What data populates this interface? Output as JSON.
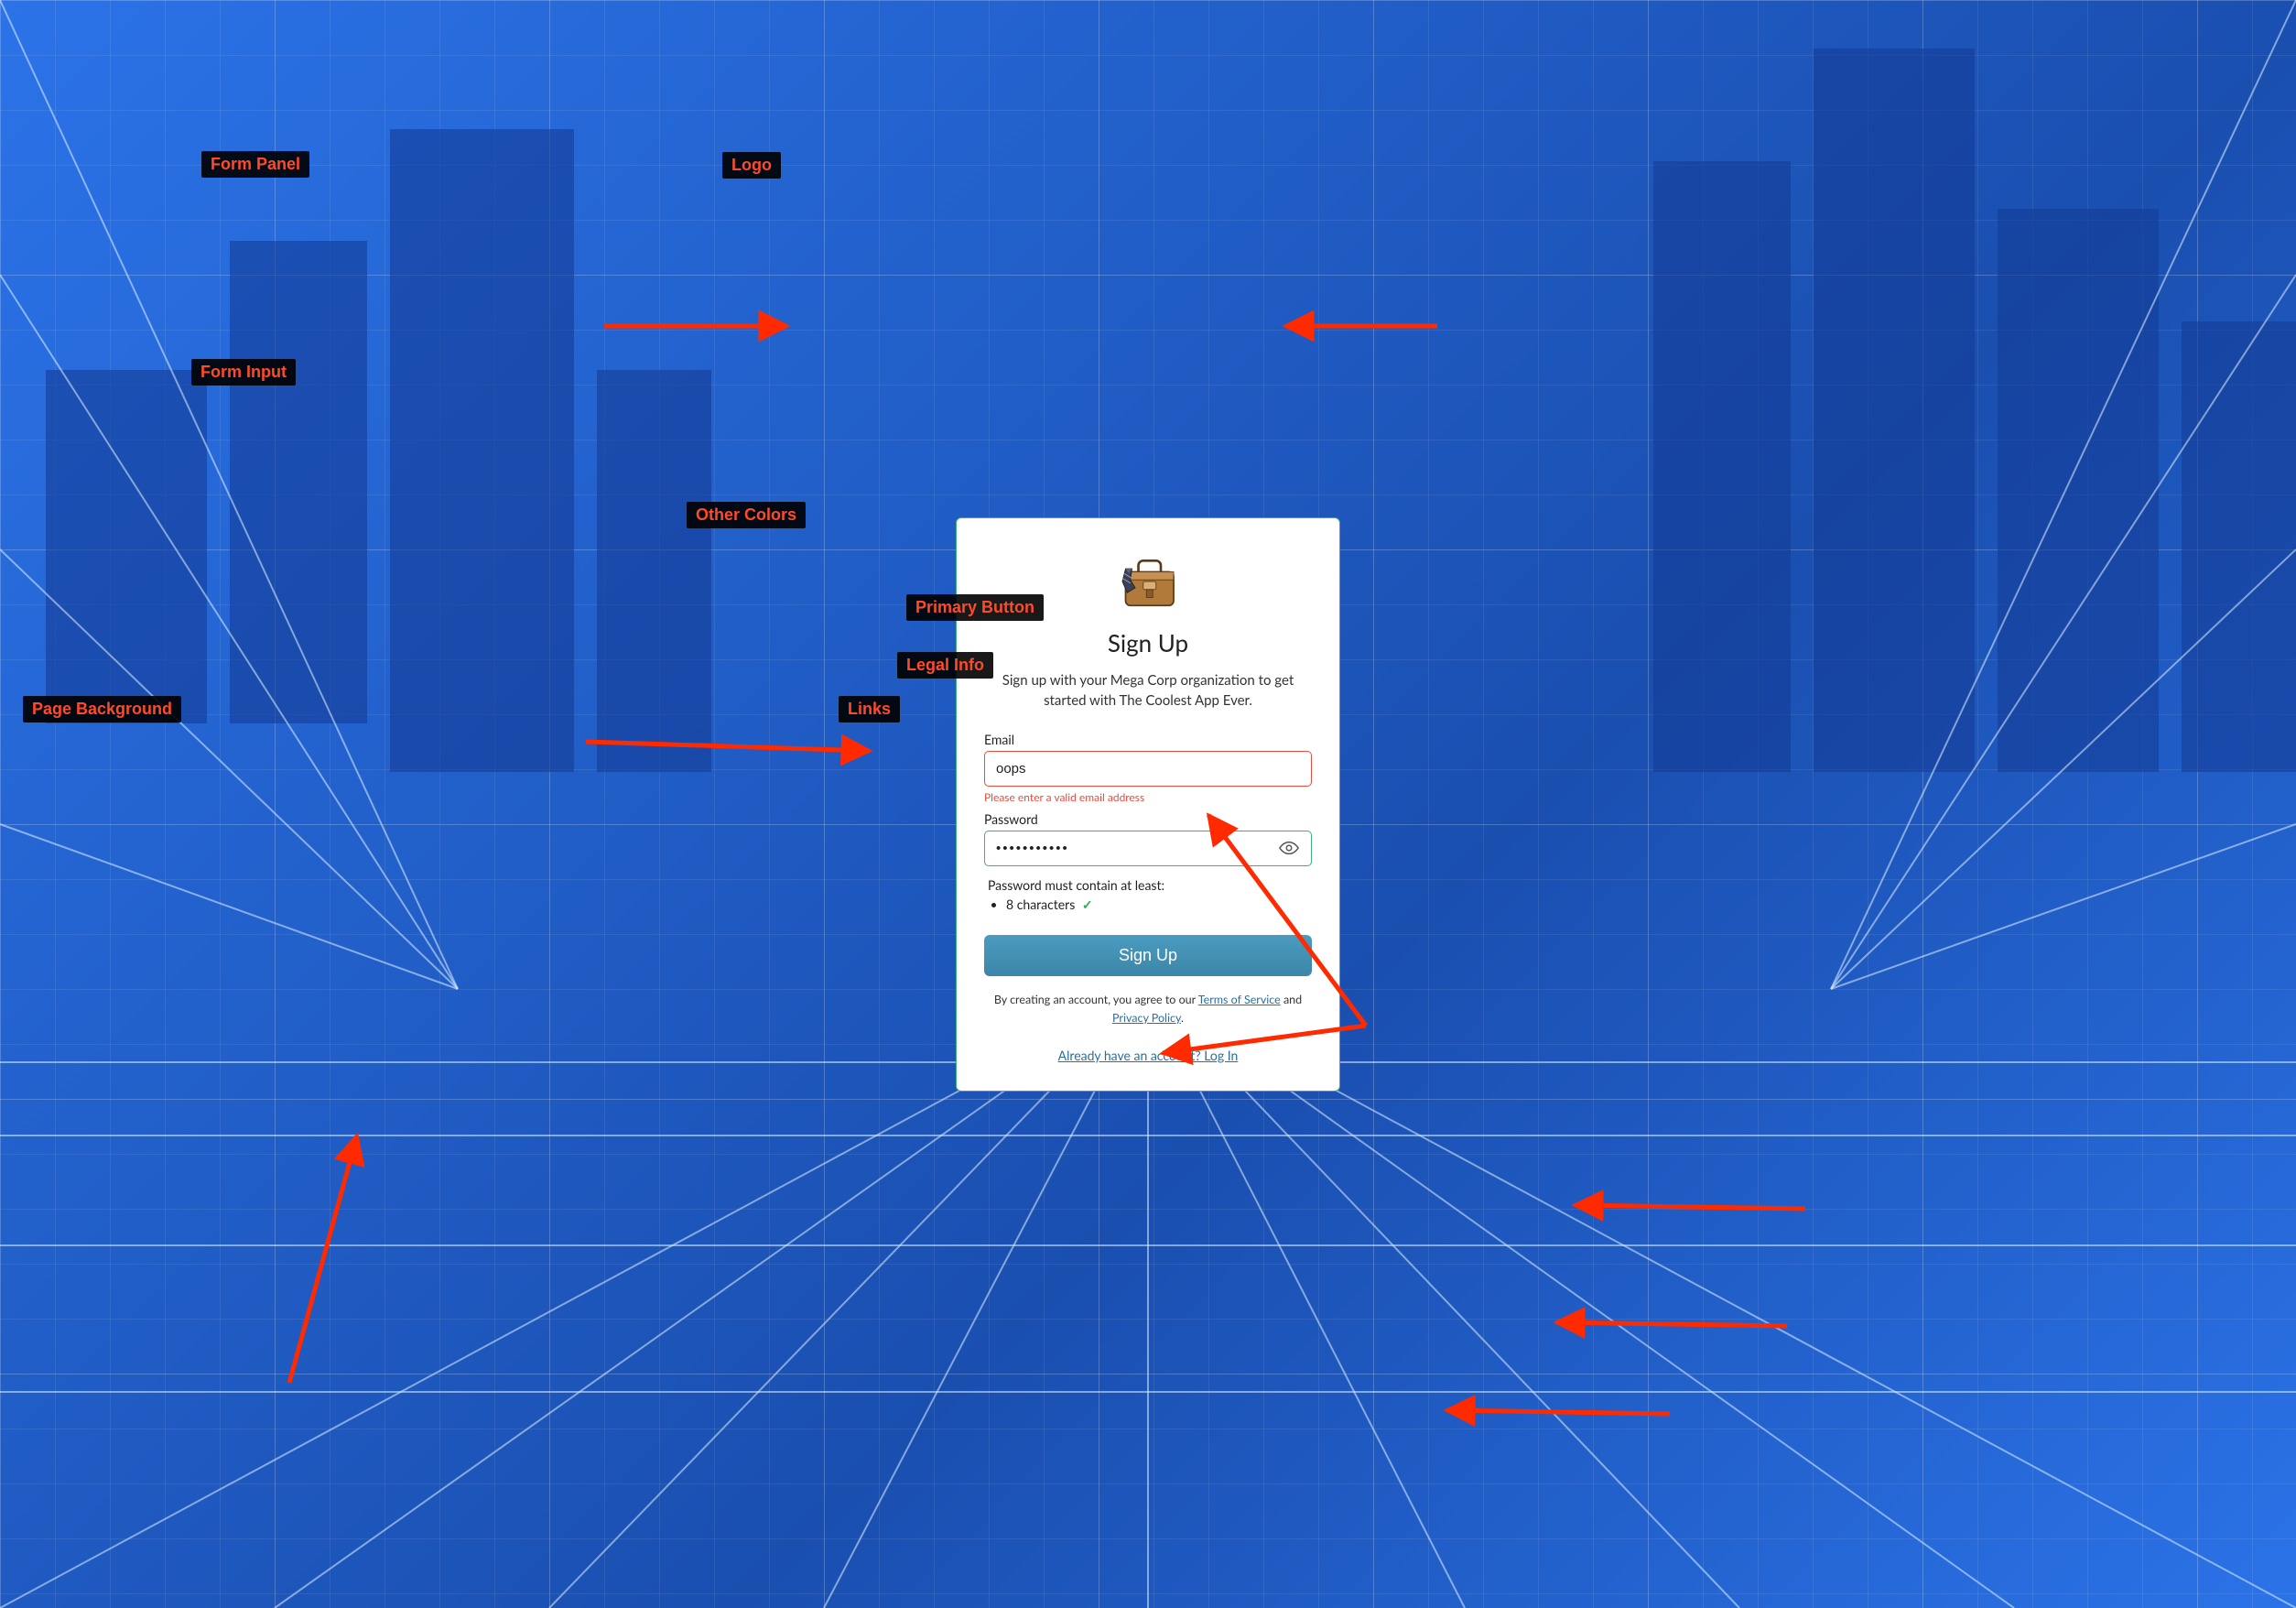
{
  "form": {
    "title": "Sign Up",
    "subtitle": "Sign up with your Mega Corp organization to get started with The Coolest App Ever.",
    "email": {
      "label": "Email",
      "value": "oops",
      "error": "Please enter a valid email address"
    },
    "password": {
      "label": "Password",
      "value": "•••••••••••",
      "requirements_title": "Password must contain at least:",
      "requirement_1": "8 characters"
    },
    "submit_label": "Sign Up",
    "legal": {
      "prefix": "By creating an account, you agree to our ",
      "tos": "Terms of Service",
      "mid": " and ",
      "privacy": "Privacy Policy",
      "suffix": "."
    },
    "login": {
      "prompt": "Already have an account?  ",
      "action": "Log In"
    }
  },
  "annotations": {
    "form_panel": "Form Panel",
    "logo": "Logo",
    "form_input": "Form Input",
    "other_colors": "Other Colors",
    "primary_button": "Primary Button",
    "legal_info": "Legal Info",
    "links": "Links",
    "page_background": "Page Background"
  },
  "colors": {
    "primary_button": "#3e8fb0",
    "link": "#2a6fa0",
    "error": "#e74c3c",
    "success": "#3cb371",
    "background": "#1e5fc7"
  }
}
